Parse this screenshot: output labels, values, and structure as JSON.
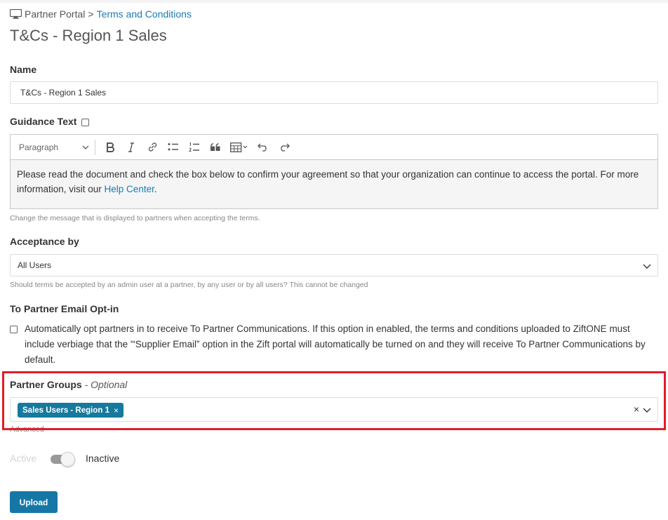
{
  "breadcrumb": {
    "icon": "monitor-icon",
    "root": "Partner Portal",
    "separator": ">",
    "current": "Terms and Conditions"
  },
  "page_title": "T&Cs - Region 1 Sales",
  "name_field": {
    "label": "Name",
    "value": "T&Cs - Region 1 Sales"
  },
  "guidance": {
    "label": "Guidance Text",
    "toolbar": {
      "paragraph_select": "Paragraph",
      "buttons": [
        "bold-icon",
        "italic-icon",
        "link-icon",
        "bulleted-list-icon",
        "numbered-list-icon",
        "blockquote-icon",
        "table-icon",
        "undo-icon",
        "redo-icon"
      ]
    },
    "body_text": "Please read the document and check the box below to confirm your agreement so that your organization can continue to access the portal. For more information, visit our ",
    "body_link": "Help Center",
    "body_end": ".",
    "help": "Change the message that is displayed to partners when accepting the terms."
  },
  "acceptance": {
    "label": "Acceptance by",
    "value": "All Users",
    "help": "Should terms be accepted by an admin user at a partner, by any user or by all users? This cannot be changed"
  },
  "email_optin": {
    "label": "To Partner Email Opt-in",
    "text": "Automatically opt partners in to receive To Partner Communications. If this option in enabled, the terms and conditions uploaded to ZiftONE must include verbiage that the '“Supplier Email” option in the Zift portal will automatically be turned on and they will receive To Partner Communications by default."
  },
  "partner_groups": {
    "label": "Partner Groups",
    "optional": "- Optional",
    "tags": [
      "Sales Users - Region 1"
    ],
    "tag_remove": "×",
    "clear": "×"
  },
  "advanced": "Advanced",
  "status": {
    "active_label": "Active",
    "inactive_label": "Inactive",
    "is_active": false
  },
  "upload_label": "Upload",
  "colors": {
    "accent": "#1677a7",
    "link": "#1a7bb0",
    "highlight": "#e21c2a"
  }
}
